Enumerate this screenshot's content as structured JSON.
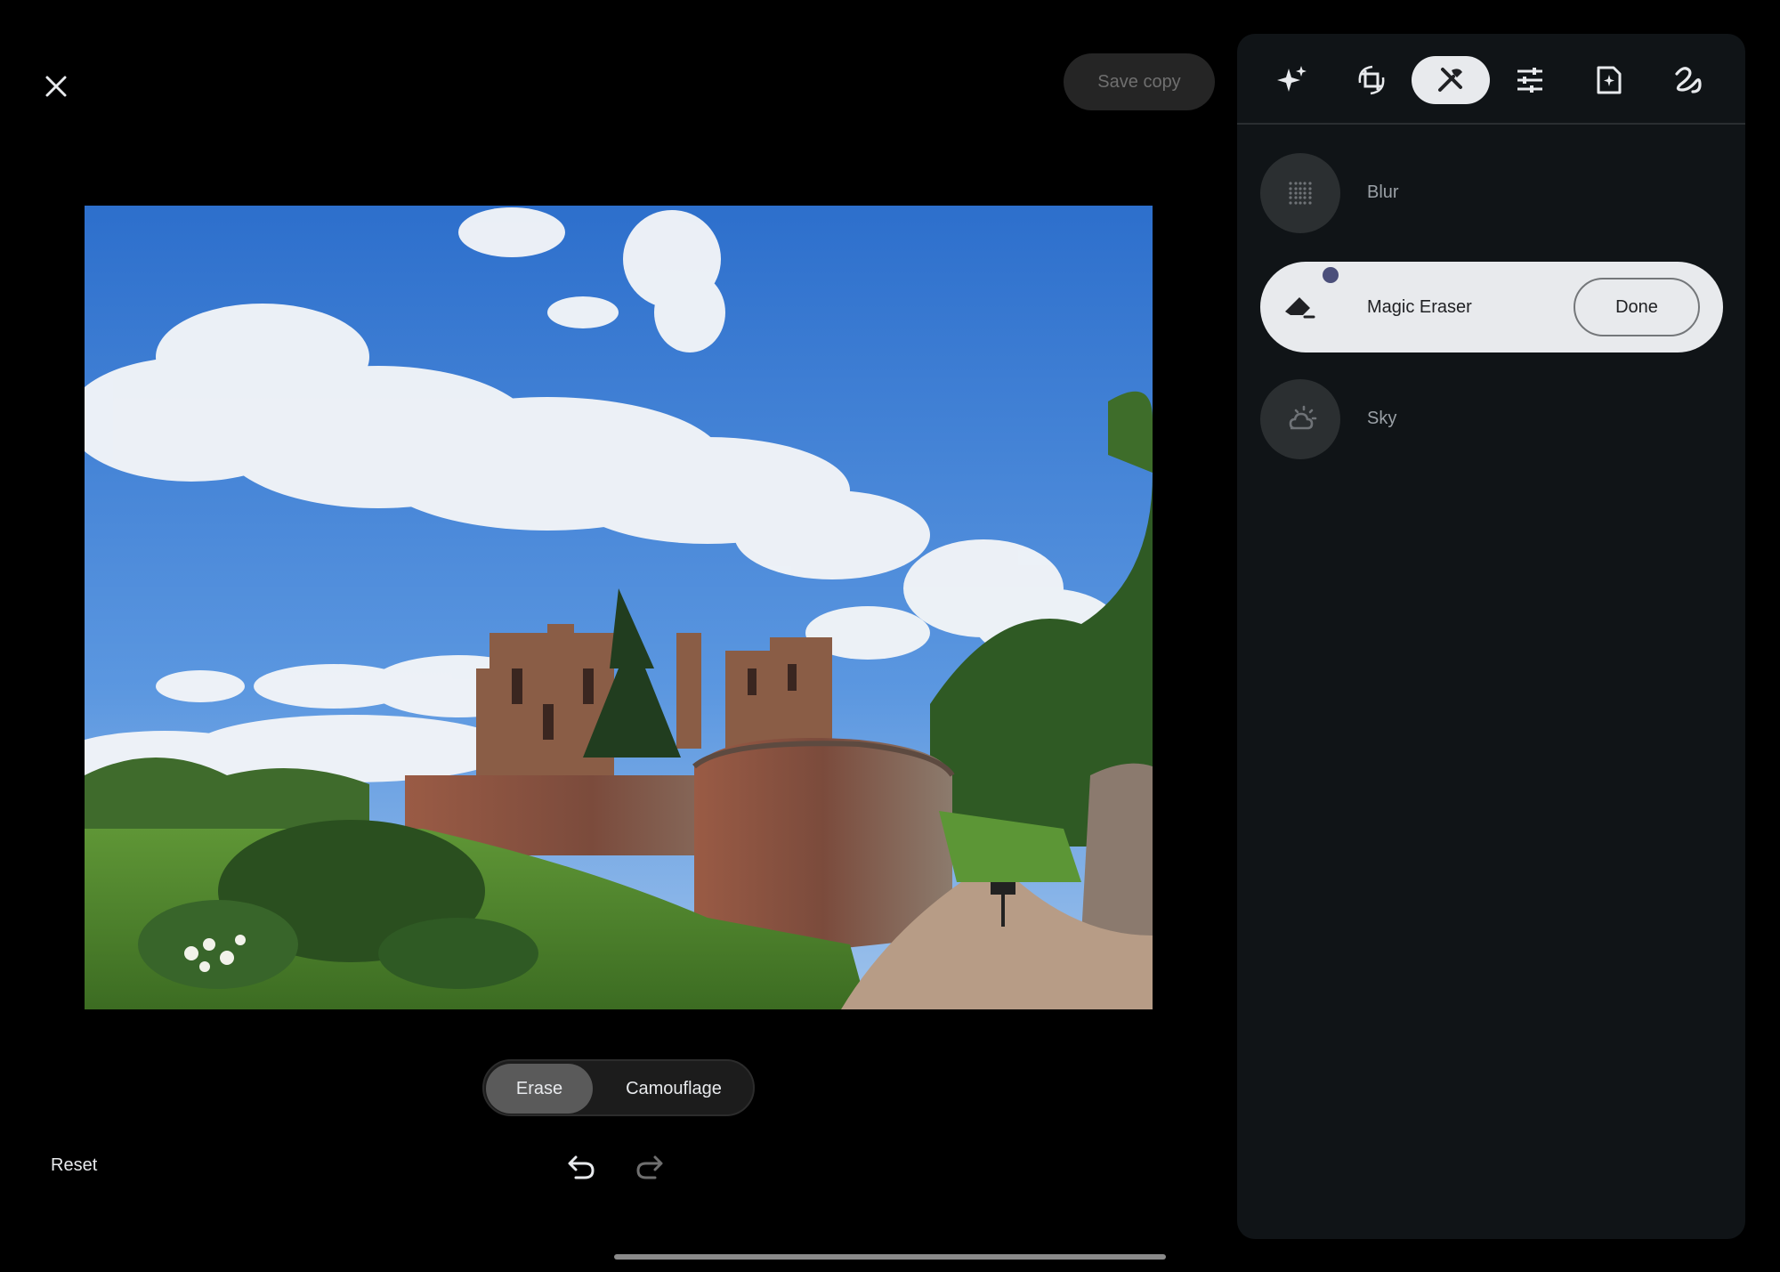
{
  "toolbar": {
    "close_icon": "close-icon",
    "save_copy_label": "Save copy"
  },
  "editor": {
    "modes": [
      {
        "label": "Erase",
        "selected": true
      },
      {
        "label": "Camouflage",
        "selected": false
      }
    ],
    "reset_label": "Reset",
    "undo_icon": "undo-icon",
    "redo_icon": "redo-icon"
  },
  "panel": {
    "tabs": [
      {
        "icon": "sparkle-icon",
        "active": false
      },
      {
        "icon": "crop-rotate-icon",
        "active": false
      },
      {
        "icon": "tools-icon",
        "active": true
      },
      {
        "icon": "adjust-sliders-icon",
        "active": false
      },
      {
        "icon": "filters-icon",
        "active": false
      },
      {
        "icon": "markup-icon",
        "active": false
      }
    ],
    "tools": {
      "blur": {
        "label": "Blur",
        "icon": "blur-icon"
      },
      "magic_eraser": {
        "label": "Magic Eraser",
        "icon": "eraser-icon",
        "done_label": "Done"
      },
      "sky": {
        "label": "Sky",
        "icon": "sky-icon"
      }
    }
  },
  "colors": {
    "background": "#000000",
    "panel": "#101417",
    "active_pill": "#e8eaed",
    "accent_dot": "#4b4f7a"
  }
}
